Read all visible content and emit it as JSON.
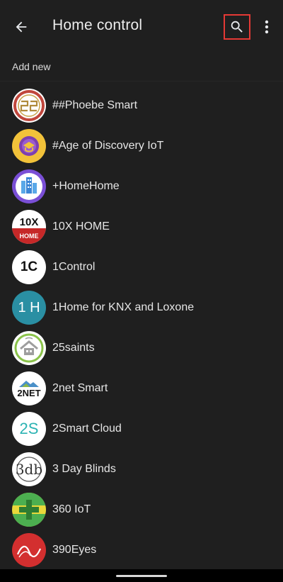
{
  "header": {
    "title": "Home control",
    "back_icon": "arrow-back-icon",
    "search_icon": "search-icon",
    "more_icon": "more-vert-icon",
    "highlight_color": "#e53935"
  },
  "section": {
    "label": "Add new"
  },
  "items": [
    {
      "label": "##Phoebe Smart"
    },
    {
      "label": "#Age of Discovery IoT"
    },
    {
      "label": "+HomeHome"
    },
    {
      "label": "10X HOME"
    },
    {
      "label": "1Control"
    },
    {
      "label": "1Home for KNX and Loxone"
    },
    {
      "label": "25saints"
    },
    {
      "label": "2net Smart"
    },
    {
      "label": "2Smart Cloud"
    },
    {
      "label": "3 Day Blinds"
    },
    {
      "label": "360 IoT"
    },
    {
      "label": "390Eyes"
    }
  ],
  "logos": {
    "tenx_top": "10X",
    "tenx_bottom": "HOME",
    "onecontrol": "1C",
    "onehome": "1 H",
    "twonet": "2NET",
    "twosmart": "2S",
    "threeday": "3db"
  }
}
